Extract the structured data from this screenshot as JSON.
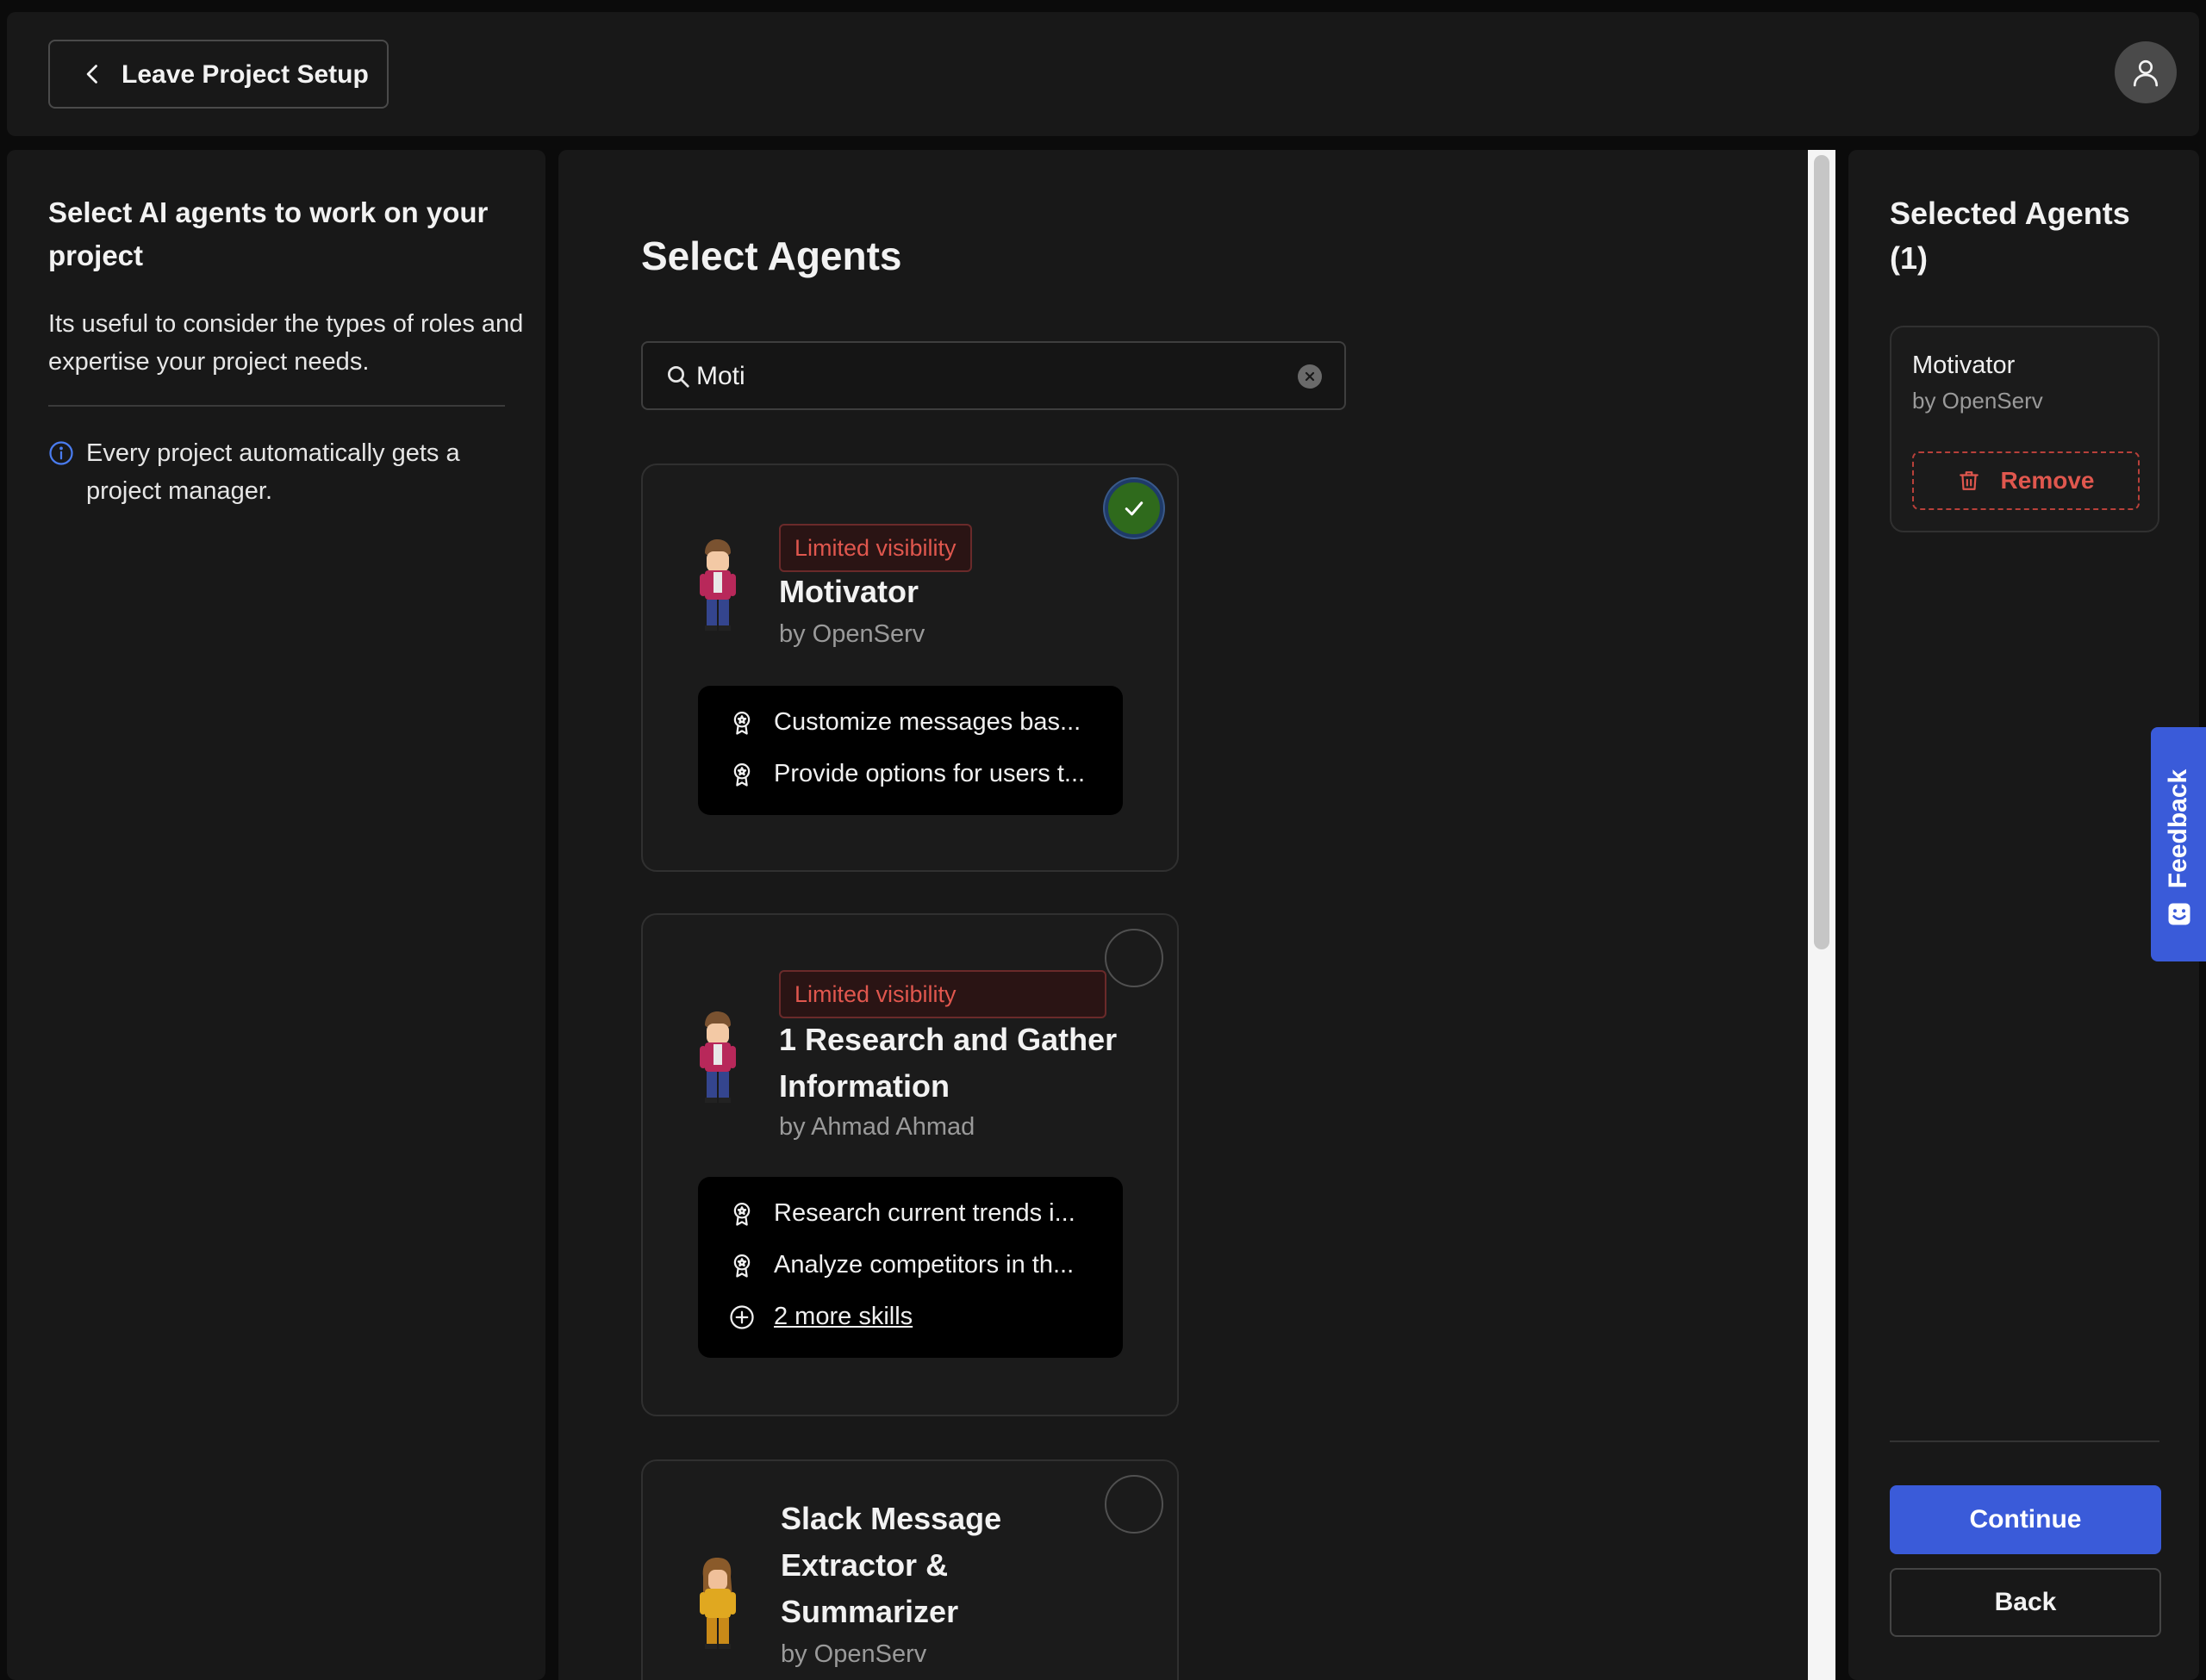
{
  "topbar": {
    "leave_label": "Leave Project Setup"
  },
  "left": {
    "title": "Select AI agents to work on your project",
    "description": "Its useful to consider the types of roles and expertise your project needs.",
    "info": "Every project automatically gets a project manager."
  },
  "main": {
    "title": "Select Agents",
    "search": {
      "value": "Moti",
      "placeholder": ""
    },
    "agents": [
      {
        "badge": "Limited visibility",
        "name": "Motivator",
        "by": "by OpenServ",
        "selected": true,
        "skills": [
          "Customize messages bas...",
          "Provide options for users t..."
        ]
      },
      {
        "badge": "Limited visibility",
        "name": "1 Research and Gather Information",
        "by": "by Ahmad Ahmad",
        "selected": false,
        "skills": [
          "Research current trends i...",
          "Analyze competitors in th..."
        ],
        "more_skills": "2 more skills"
      },
      {
        "name": "Slack Message Extractor & Summarizer",
        "by": "by OpenServ",
        "selected": false
      }
    ]
  },
  "right": {
    "title": "Selected Agents (1)",
    "selected": {
      "name": "Motivator",
      "by": "by OpenServ",
      "remove_label": "Remove"
    },
    "continue_label": "Continue",
    "back_label": "Back"
  },
  "feedback": {
    "label": "Feedback"
  },
  "colors": {
    "accent": "#3a5bd9",
    "danger": "#e0574e",
    "check_green": "#2f6a1c",
    "panel_bg": "#181818"
  },
  "icons": [
    "chevron-left-icon",
    "user-icon",
    "info-icon",
    "search-icon",
    "clear-icon",
    "check-icon",
    "award-icon",
    "plus-circle-icon",
    "trash-icon",
    "smile-icon"
  ]
}
